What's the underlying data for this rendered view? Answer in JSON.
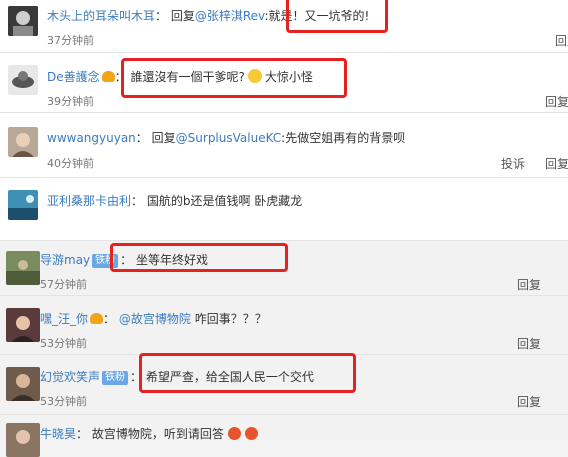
{
  "comments": [
    {
      "name": "木头上的耳朵叫木耳",
      "sep": "：",
      "reply_word": "回复",
      "mention": "@张梓淇Rev",
      "text": ":就是！又一坑爷的!",
      "time": "37分钟前",
      "actions": [
        "回复"
      ]
    },
    {
      "name": "De善護念",
      "sep": "：",
      "text": "誰還沒有一個干爹呢?",
      "emoji_text": "大惊小怪",
      "time": "39分钟前",
      "actions": [
        "回复"
      ]
    },
    {
      "name": "wwwangyuyan",
      "sep": "：",
      "reply_word": "回复",
      "mention": "@SurplusValueKC",
      "text": ":先做空姐再有的背景呗",
      "time": "40分钟前",
      "actions": [
        "投诉",
        "回复"
      ]
    },
    {
      "name": "亚利桑那卡由利",
      "sep": "：",
      "text": "国航的b还是值钱啊 卧虎藏龙"
    },
    {
      "name": "导游may",
      "badge": "铁粉",
      "sep": "：",
      "text": "坐等年终好戏",
      "time": "57分钟前",
      "actions": [
        "回复"
      ]
    },
    {
      "name": "嘿_汪_你",
      "sep": "：",
      "mention": "@故宫博物院",
      "text": " 咋回事？？？",
      "time": "53分钟前",
      "actions": [
        "回复"
      ]
    },
    {
      "name": "幻觉欢笑声",
      "badge": "铁粉",
      "sep": "：",
      "text": "希望严查，给全国人民一个交代",
      "time": "53分钟前",
      "actions": [
        "回复"
      ]
    },
    {
      "name": "牛晓昊",
      "sep": "：",
      "text": "故宫博物院，听到请回答"
    }
  ],
  "colors": {
    "link": "#3b7bbf",
    "highlight_box": "#e52222",
    "badge": "#6aa7e6"
  },
  "icons": [
    "avatar",
    "crown-icon",
    "emoji-icon"
  ]
}
